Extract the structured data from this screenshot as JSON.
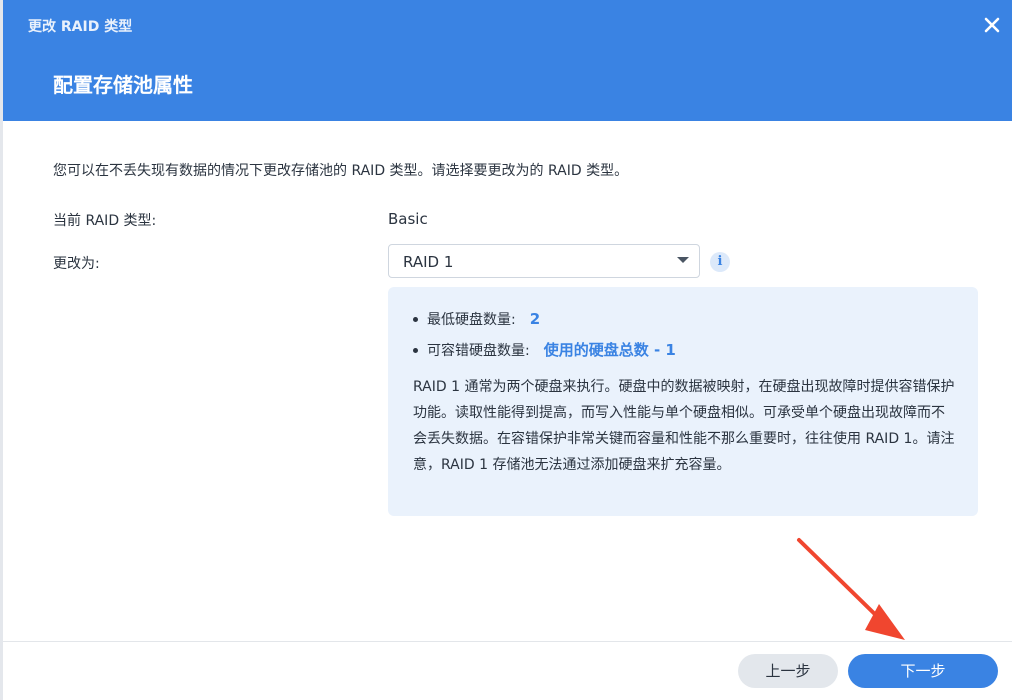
{
  "window": {
    "title": "更改 RAID 类型",
    "close_icon": "close-icon"
  },
  "step": {
    "title": "配置存储池属性"
  },
  "content": {
    "description": "您可以在不丢失现有数据的情况下更改存储池的 RAID 类型。请选择要更改为的 RAID 类型。",
    "current_raid_label": "当前 RAID 类型:",
    "current_raid_value": "Basic",
    "change_to_label": "更改为:",
    "change_to_selected": "RAID 1",
    "info_icon": "info-icon"
  },
  "info_panel": {
    "min_disks_label": "最低硬盘数量:",
    "min_disks_value": "2",
    "fault_tolerance_label": "可容错硬盘数量:",
    "fault_tolerance_value": "使用的硬盘总数 - 1",
    "description": "RAID 1 通常为两个硬盘来执行。硬盘中的数据被映射，在硬盘出现故障时提供容错保护功能。读取性能得到提高，而写入性能与单个硬盘相似。可承受单个硬盘出现故障而不会丢失数据。在容错保护非常关键而容量和性能不那么重要时，往往使用 RAID 1。请注意，RAID 1 存储池无法通过添加硬盘来扩充容量。"
  },
  "footer": {
    "prev_label": "上一步",
    "next_label": "下一步"
  },
  "colors": {
    "header": "#3a83e3",
    "accent": "#3a83e3",
    "info_panel_bg": "#eaf2fc",
    "annotation_arrow": "#f0462f"
  }
}
